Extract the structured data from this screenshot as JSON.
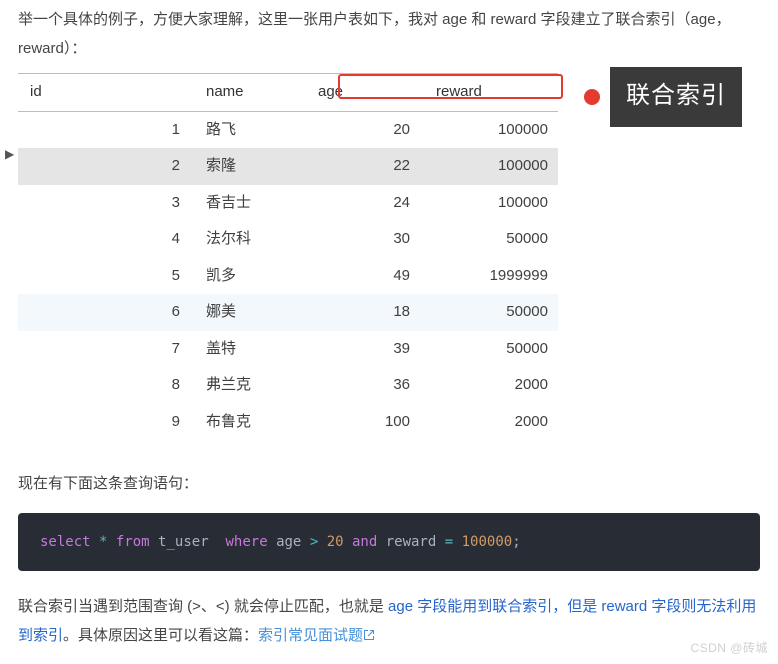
{
  "intro": "举一个具体的例子，方便大家理解，这里一张用户表如下，我对 age 和 reward 字段建立了联合索引（age，reward）：",
  "table": {
    "headers": {
      "id": "id",
      "name": "name",
      "age": "age",
      "reward": "reward"
    },
    "rows": [
      {
        "id": "1",
        "name": "路飞",
        "age": "20",
        "reward": "100000"
      },
      {
        "id": "2",
        "name": "索隆",
        "age": "22",
        "reward": "100000"
      },
      {
        "id": "3",
        "name": "香吉士",
        "age": "24",
        "reward": "100000"
      },
      {
        "id": "4",
        "name": "法尔科",
        "age": "30",
        "reward": "50000"
      },
      {
        "id": "5",
        "name": "凯多",
        "age": "49",
        "reward": "1999999"
      },
      {
        "id": "6",
        "name": "娜美",
        "age": "18",
        "reward": "50000"
      },
      {
        "id": "7",
        "name": "盖特",
        "age": "39",
        "reward": "50000"
      },
      {
        "id": "8",
        "name": "弗兰克",
        "age": "36",
        "reward": "2000"
      },
      {
        "id": "9",
        "name": "布鲁克",
        "age": "100",
        "reward": "2000"
      }
    ]
  },
  "callout_label": "联合索引",
  "mid_para": "现在有下面这条查询语句：",
  "sql": {
    "select": "select",
    "star": "*",
    "from": "from",
    "table": "t_user",
    "where": "where",
    "c1": "age",
    "op1": ">",
    "v1": "20",
    "and": "and",
    "c2": "reward",
    "op2": "=",
    "v2": "100000",
    "semi": ";"
  },
  "tail": {
    "p1a": "联合索引当遇到范围查询 (>、<) 就会停止匹配，也就是 ",
    "p1b": "age 字段能用到联合索引，但是 reward 字段则无法利用到索引",
    "p1c": "。具体原因这里可以看这篇：",
    "link": "索引常见面试题"
  },
  "watermark": "CSDN @砖城"
}
